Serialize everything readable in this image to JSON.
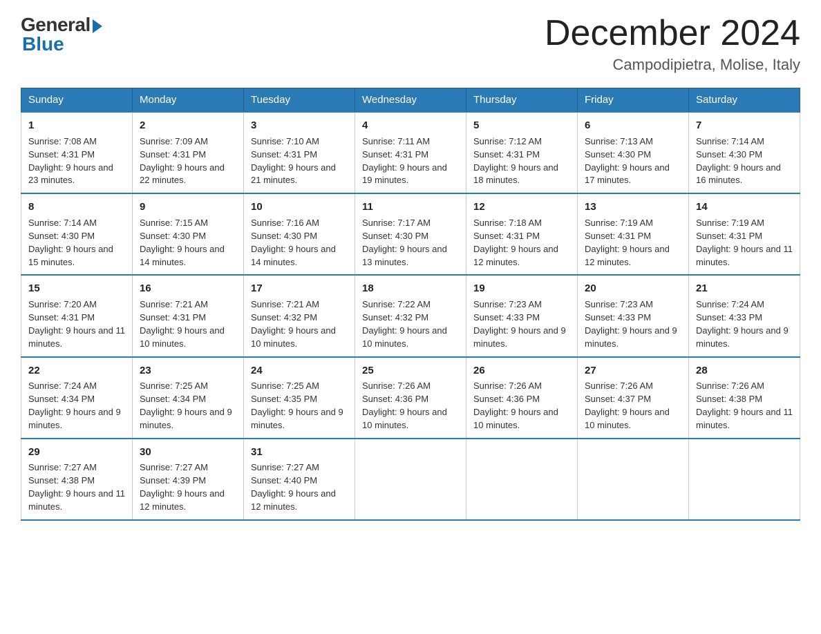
{
  "header": {
    "logo_general": "General",
    "logo_blue": "Blue",
    "month_year": "December 2024",
    "location": "Campodipietra, Molise, Italy"
  },
  "days_of_week": [
    "Sunday",
    "Monday",
    "Tuesday",
    "Wednesday",
    "Thursday",
    "Friday",
    "Saturday"
  ],
  "weeks": [
    [
      {
        "day": "1",
        "sunrise": "7:08 AM",
        "sunset": "4:31 PM",
        "daylight": "9 hours and 23 minutes."
      },
      {
        "day": "2",
        "sunrise": "7:09 AM",
        "sunset": "4:31 PM",
        "daylight": "9 hours and 22 minutes."
      },
      {
        "day": "3",
        "sunrise": "7:10 AM",
        "sunset": "4:31 PM",
        "daylight": "9 hours and 21 minutes."
      },
      {
        "day": "4",
        "sunrise": "7:11 AM",
        "sunset": "4:31 PM",
        "daylight": "9 hours and 19 minutes."
      },
      {
        "day": "5",
        "sunrise": "7:12 AM",
        "sunset": "4:31 PM",
        "daylight": "9 hours and 18 minutes."
      },
      {
        "day": "6",
        "sunrise": "7:13 AM",
        "sunset": "4:30 PM",
        "daylight": "9 hours and 17 minutes."
      },
      {
        "day": "7",
        "sunrise": "7:14 AM",
        "sunset": "4:30 PM",
        "daylight": "9 hours and 16 minutes."
      }
    ],
    [
      {
        "day": "8",
        "sunrise": "7:14 AM",
        "sunset": "4:30 PM",
        "daylight": "9 hours and 15 minutes."
      },
      {
        "day": "9",
        "sunrise": "7:15 AM",
        "sunset": "4:30 PM",
        "daylight": "9 hours and 14 minutes."
      },
      {
        "day": "10",
        "sunrise": "7:16 AM",
        "sunset": "4:30 PM",
        "daylight": "9 hours and 14 minutes."
      },
      {
        "day": "11",
        "sunrise": "7:17 AM",
        "sunset": "4:30 PM",
        "daylight": "9 hours and 13 minutes."
      },
      {
        "day": "12",
        "sunrise": "7:18 AM",
        "sunset": "4:31 PM",
        "daylight": "9 hours and 12 minutes."
      },
      {
        "day": "13",
        "sunrise": "7:19 AM",
        "sunset": "4:31 PM",
        "daylight": "9 hours and 12 minutes."
      },
      {
        "day": "14",
        "sunrise": "7:19 AM",
        "sunset": "4:31 PM",
        "daylight": "9 hours and 11 minutes."
      }
    ],
    [
      {
        "day": "15",
        "sunrise": "7:20 AM",
        "sunset": "4:31 PM",
        "daylight": "9 hours and 11 minutes."
      },
      {
        "day": "16",
        "sunrise": "7:21 AM",
        "sunset": "4:31 PM",
        "daylight": "9 hours and 10 minutes."
      },
      {
        "day": "17",
        "sunrise": "7:21 AM",
        "sunset": "4:32 PM",
        "daylight": "9 hours and 10 minutes."
      },
      {
        "day": "18",
        "sunrise": "7:22 AM",
        "sunset": "4:32 PM",
        "daylight": "9 hours and 10 minutes."
      },
      {
        "day": "19",
        "sunrise": "7:23 AM",
        "sunset": "4:33 PM",
        "daylight": "9 hours and 9 minutes."
      },
      {
        "day": "20",
        "sunrise": "7:23 AM",
        "sunset": "4:33 PM",
        "daylight": "9 hours and 9 minutes."
      },
      {
        "day": "21",
        "sunrise": "7:24 AM",
        "sunset": "4:33 PM",
        "daylight": "9 hours and 9 minutes."
      }
    ],
    [
      {
        "day": "22",
        "sunrise": "7:24 AM",
        "sunset": "4:34 PM",
        "daylight": "9 hours and 9 minutes."
      },
      {
        "day": "23",
        "sunrise": "7:25 AM",
        "sunset": "4:34 PM",
        "daylight": "9 hours and 9 minutes."
      },
      {
        "day": "24",
        "sunrise": "7:25 AM",
        "sunset": "4:35 PM",
        "daylight": "9 hours and 9 minutes."
      },
      {
        "day": "25",
        "sunrise": "7:26 AM",
        "sunset": "4:36 PM",
        "daylight": "9 hours and 10 minutes."
      },
      {
        "day": "26",
        "sunrise": "7:26 AM",
        "sunset": "4:36 PM",
        "daylight": "9 hours and 10 minutes."
      },
      {
        "day": "27",
        "sunrise": "7:26 AM",
        "sunset": "4:37 PM",
        "daylight": "9 hours and 10 minutes."
      },
      {
        "day": "28",
        "sunrise": "7:26 AM",
        "sunset": "4:38 PM",
        "daylight": "9 hours and 11 minutes."
      }
    ],
    [
      {
        "day": "29",
        "sunrise": "7:27 AM",
        "sunset": "4:38 PM",
        "daylight": "9 hours and 11 minutes."
      },
      {
        "day": "30",
        "sunrise": "7:27 AM",
        "sunset": "4:39 PM",
        "daylight": "9 hours and 12 minutes."
      },
      {
        "day": "31",
        "sunrise": "7:27 AM",
        "sunset": "4:40 PM",
        "daylight": "9 hours and 12 minutes."
      },
      null,
      null,
      null,
      null
    ]
  ],
  "labels": {
    "sunrise": "Sunrise:",
    "sunset": "Sunset:",
    "daylight": "Daylight:"
  }
}
